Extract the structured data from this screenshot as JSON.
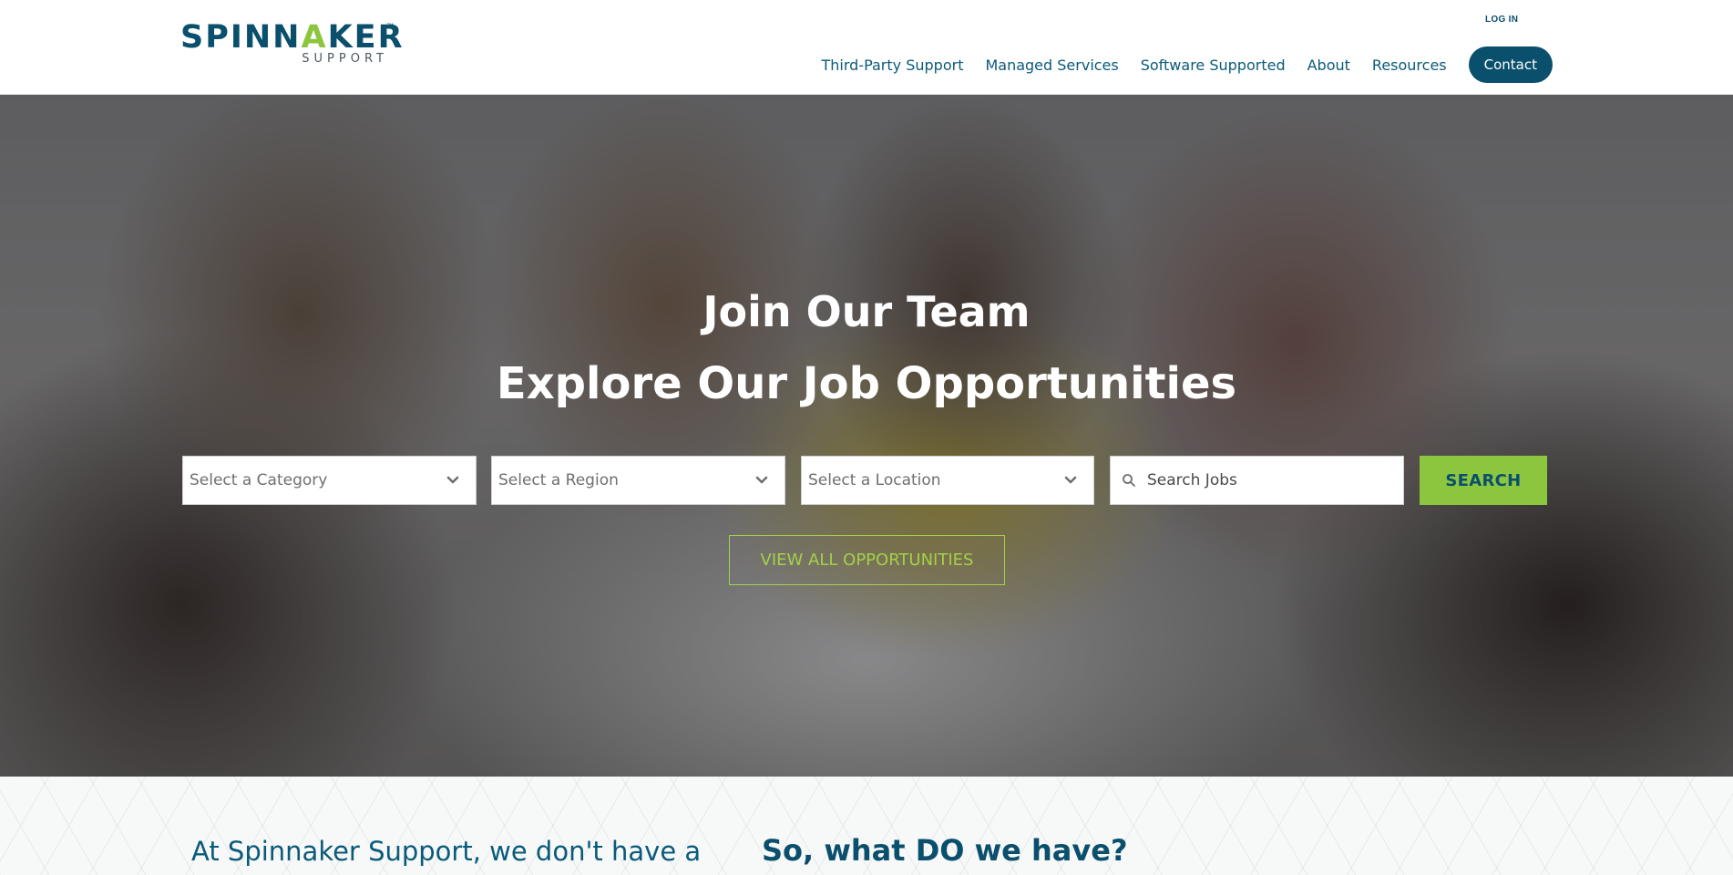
{
  "logo": {
    "wordmark_start": "SPINN",
    "wordmark_accent": "A",
    "wordmark_end": "KER",
    "trademark": "™",
    "subtext": "SUPPORT"
  },
  "header": {
    "login_label": "LOG IN",
    "nav": [
      "Third-Party Support",
      "Managed Services",
      "Software Supported",
      "About",
      "Resources"
    ],
    "contact_label": "Contact"
  },
  "hero": {
    "title": "Join Our Team",
    "subtitle": "Explore Our Job Opportunities",
    "filters": {
      "category": "Select a Category",
      "region": "Select a Region",
      "location": "Select a Location"
    },
    "search_placeholder": "Search Jobs",
    "search_label": "SEARCH",
    "view_all_label": "VIEW ALL OPPORTUNITIES"
  },
  "intro": {
    "left_text": "At Spinnaker Support, we don't have a",
    "right_heading": "So, what DO we have?"
  },
  "colors": {
    "brand_navy": "#0a4f6c",
    "brand_green": "#8cc63f"
  }
}
